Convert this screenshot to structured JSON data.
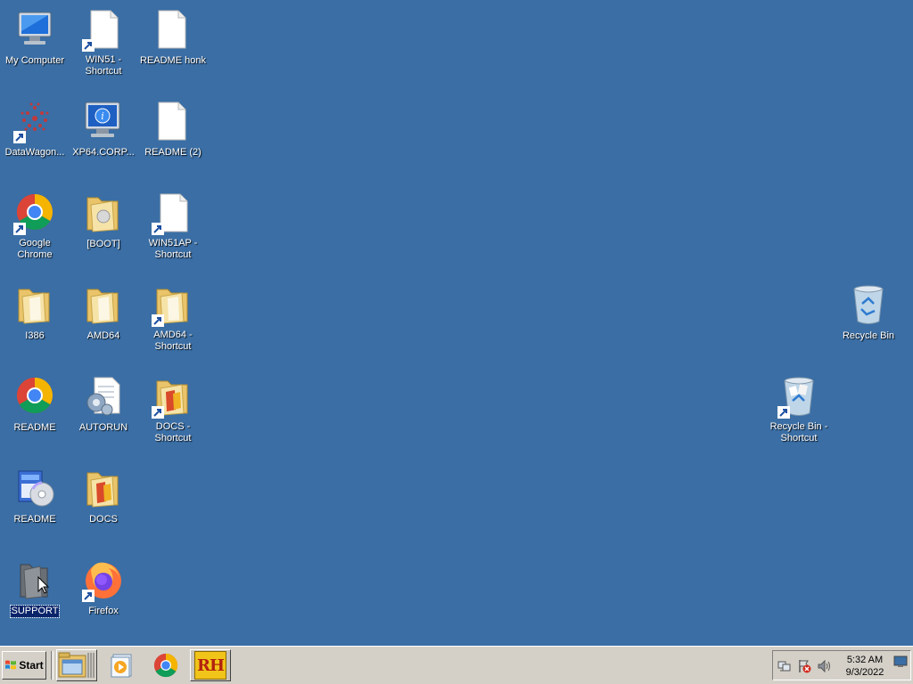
{
  "desktop": {
    "background": "#3a6ea5",
    "icons": [
      {
        "label": "My Computer",
        "icon": "computer-icon"
      },
      {
        "label": "WIN51 -\nShortcut",
        "icon": "file-shortcut-icon"
      },
      {
        "label": "README honk",
        "icon": "file-icon"
      },
      {
        "label": "DataWagon...",
        "icon": "datawagon-icon"
      },
      {
        "label": "XP64.CORP...",
        "icon": "info-monitor-icon"
      },
      {
        "label": "README  (2)",
        "icon": "file-icon"
      },
      {
        "label": "Google Chrome",
        "icon": "chrome-shortcut-icon"
      },
      {
        "label": "[BOOT]",
        "icon": "folder-icon"
      },
      {
        "label": "WIN51AP -\nShortcut",
        "icon": "file-shortcut-icon"
      },
      {
        "label": "I386",
        "icon": "folder-icon"
      },
      {
        "label": "AMD64",
        "icon": "folder-icon"
      },
      {
        "label": "AMD64 -\nShortcut",
        "icon": "folder-shortcut-icon"
      },
      {
        "label": "README",
        "icon": "chrome-icon"
      },
      {
        "label": "AUTORUN",
        "icon": "settings-file-icon"
      },
      {
        "label": "DOCS -\nShortcut",
        "icon": "folder-shortcut-icon"
      },
      {
        "label": "README",
        "icon": "setup-disc-icon"
      },
      {
        "label": "DOCS",
        "icon": "folder-icon"
      },
      {
        "label": "SUPPORT",
        "icon": "dark-folder-icon"
      },
      {
        "label": "Firefox",
        "icon": "firefox-shortcut-icon"
      },
      {
        "label": "Recycle Bin",
        "icon": "recycle-bin-icon"
      },
      {
        "label": "Recycle Bin -\nShortcut",
        "icon": "recycle-bin-shortcut-icon"
      }
    ]
  },
  "taskbar": {
    "start_label": "Start",
    "pinned": [
      "file-explorer-icon",
      "media-player-icon",
      "chrome-icon",
      "rh-app-icon"
    ],
    "rh_label": "RH",
    "clock": {
      "time": "5:32 AM",
      "date": "9/3/2022"
    },
    "tray_icons": [
      "network-icon",
      "action-center-icon",
      "volume-icon"
    ]
  }
}
